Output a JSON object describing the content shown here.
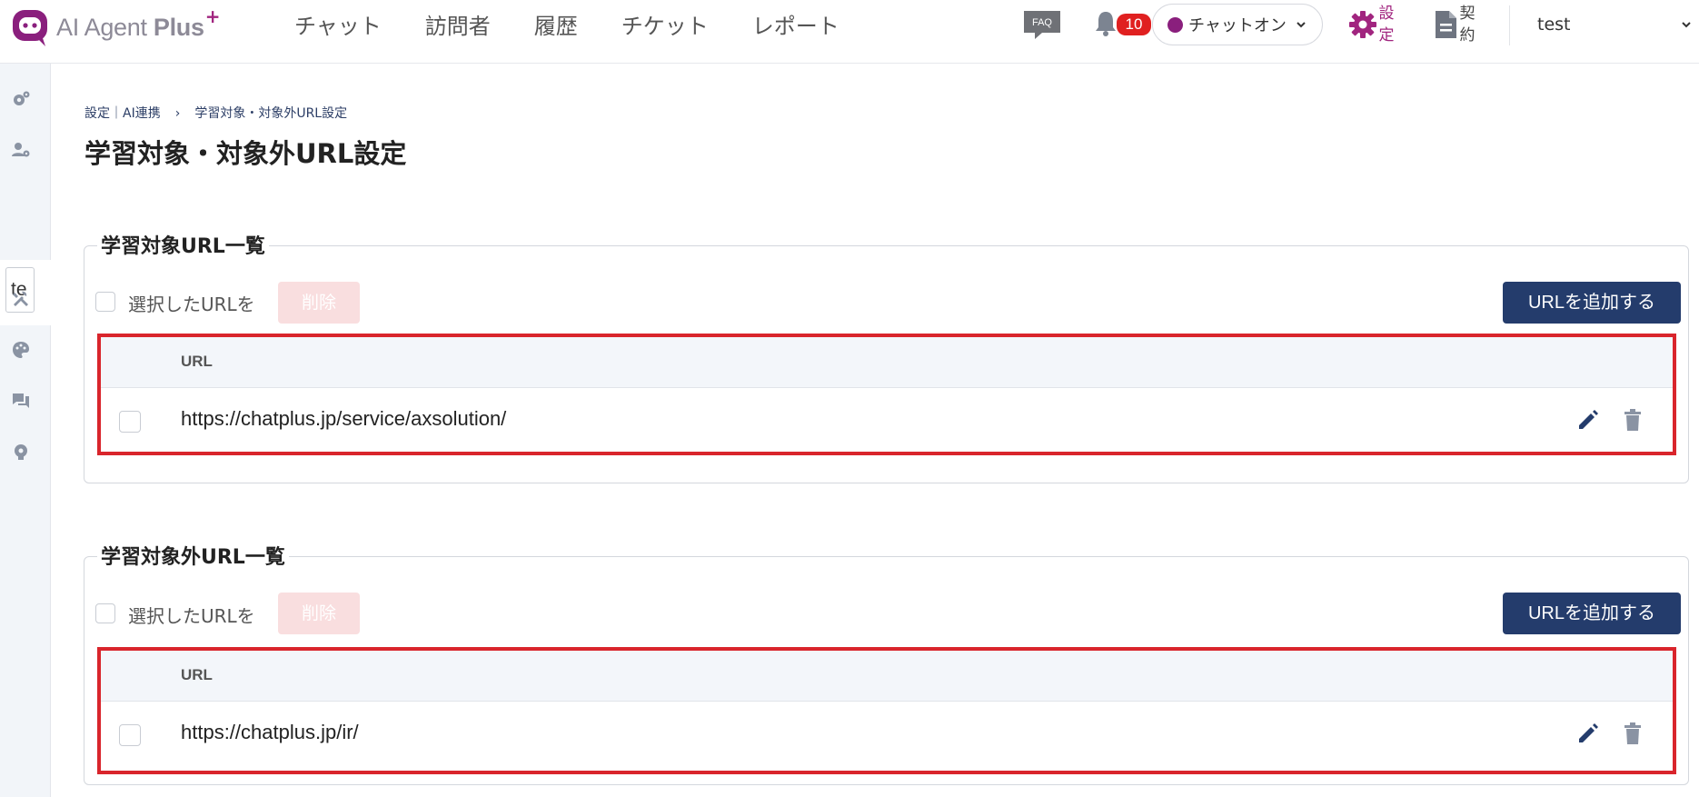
{
  "app": {
    "name_part1": "AI Agent ",
    "name_part2": "Plus",
    "name_plus": "+"
  },
  "nav": {
    "items": [
      "チャット",
      "訪問者",
      "履歴",
      "チケット",
      "レポート"
    ]
  },
  "header": {
    "faq_label": "FAQ",
    "notification_count": "10",
    "status_label": "チャットオン",
    "settings_label_1": "設",
    "settings_label_2": "定",
    "contract_label_1": "契",
    "contract_label_2": "約",
    "user_name": "test"
  },
  "sidebar": {
    "input_value": "te",
    "icons": [
      "settings-gear-icon",
      "user-settings-icon",
      "tools-icon",
      "palette-icon",
      "chat-bubbles-icon",
      "ai-settings-icon"
    ]
  },
  "breadcrumb": {
    "parent": "設定｜AI連携",
    "separator": "›",
    "current": "学習対象・対象外URL設定"
  },
  "page": {
    "title": "学習対象・対象外URL設定"
  },
  "sections": [
    {
      "legend": "学習対象URL一覧",
      "select_label": "選択したURLを",
      "delete_label": "削除",
      "add_label": "URLを追加する",
      "column_header": "URL",
      "rows": [
        "https://chatplus.jp/service/axsolution/"
      ]
    },
    {
      "legend": "学習対象外URL一覧",
      "select_label": "選択したURLを",
      "delete_label": "削除",
      "add_label": "URLを追加する",
      "column_header": "URL",
      "rows": [
        "https://chatplus.jp/ir/"
      ]
    }
  ],
  "colors": {
    "brand_purple": "#a1257f",
    "primary_navy": "#243c6c",
    "highlight_red": "#d9252c",
    "delete_disabled": "#f9dedf"
  }
}
